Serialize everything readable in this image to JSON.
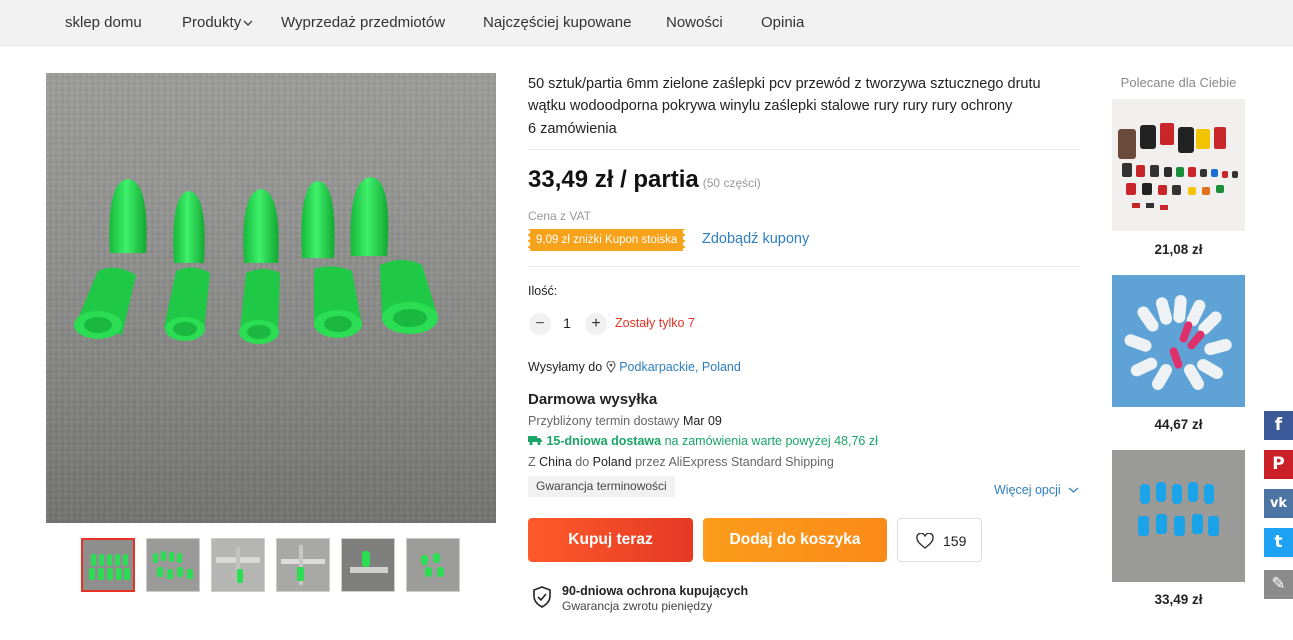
{
  "nav": {
    "items": [
      {
        "label": "sklep domu"
      },
      {
        "label": "Produkty",
        "has_dropdown": true
      },
      {
        "label": "Wyprzedaż przedmiotów"
      },
      {
        "label": "Najczęściej kupowane"
      },
      {
        "label": "Nowości"
      },
      {
        "label": "Opinia"
      }
    ]
  },
  "gallery": {
    "thumbnail_count": 6,
    "selected_thumbnail": 1
  },
  "product": {
    "title": "50 sztuk/partia 6mm zielone zaślepki pcv przewód z tworzywa sztucznego drutu wątku wodoodporna pokrywa winylu zaślepki stalowe rury rury rury ochrony",
    "orders": "6 zamówienia",
    "price": "33,49 zł / partia",
    "price_pieces": "(50 części)",
    "vat_note": "Cena z VAT",
    "coupon_badge": "9,09 zł zniżki Kupon stoiska",
    "coupon_link": "Zdobądź kupony"
  },
  "quantity": {
    "label": "Ilość:",
    "value": "1",
    "minus": "−",
    "plus": "+",
    "stock_note": "Zostały tylko 7"
  },
  "shipping": {
    "ship_to_label": "Wysyłamy do",
    "location": "Podkarpackie, Poland",
    "free_shipping": "Darmowa wysyłka",
    "eta_label": "Przybliżony termin dostawy",
    "eta_date": "Mar 09",
    "fast_delivery": "15-dniowa dostawa",
    "fast_delivery_note": "na zamówienia warte powyżej 48,76 zł",
    "route_from_label": "Z",
    "route_from": "China",
    "route_to_label": "do",
    "route_to": "Poland",
    "route_via": "przez AliExpress Standard Shipping",
    "guarantee_tag": "Gwarancja terminowości",
    "more_options": "Więcej opcji"
  },
  "actions": {
    "buy_now": "Kupuj teraz",
    "add_to_cart": "Dodaj do koszyka",
    "wishlist_count": "159"
  },
  "protection": {
    "title": "90-dniowa ochrona kupujących",
    "subtitle": "Gwarancja zwrotu pieniędzy"
  },
  "recommendations": {
    "title": "Polecane dla Ciebie",
    "items": [
      {
        "price": "21,08 zł"
      },
      {
        "price": "44,67 zł"
      },
      {
        "price": "33,49 zł"
      }
    ]
  },
  "share": [
    {
      "icon": "facebook-icon",
      "glyph": "f",
      "color": "#3b5998"
    },
    {
      "icon": "pinterest-icon",
      "glyph": "P",
      "color": "#cb2027"
    },
    {
      "icon": "vk-icon",
      "glyph": "vk",
      "color": "#4c75a3"
    },
    {
      "icon": "twitter-icon",
      "glyph": "t",
      "color": "#1da1f2"
    },
    {
      "icon": "edit-icon",
      "glyph": "✎",
      "color": "#8b8b8b"
    }
  ],
  "colors": {
    "accent_red": "#e43225",
    "link_blue": "#2e7ec2",
    "coupon_orange": "#f6a21a",
    "fast_green": "#1aa466",
    "product_green": "#22d24a"
  }
}
